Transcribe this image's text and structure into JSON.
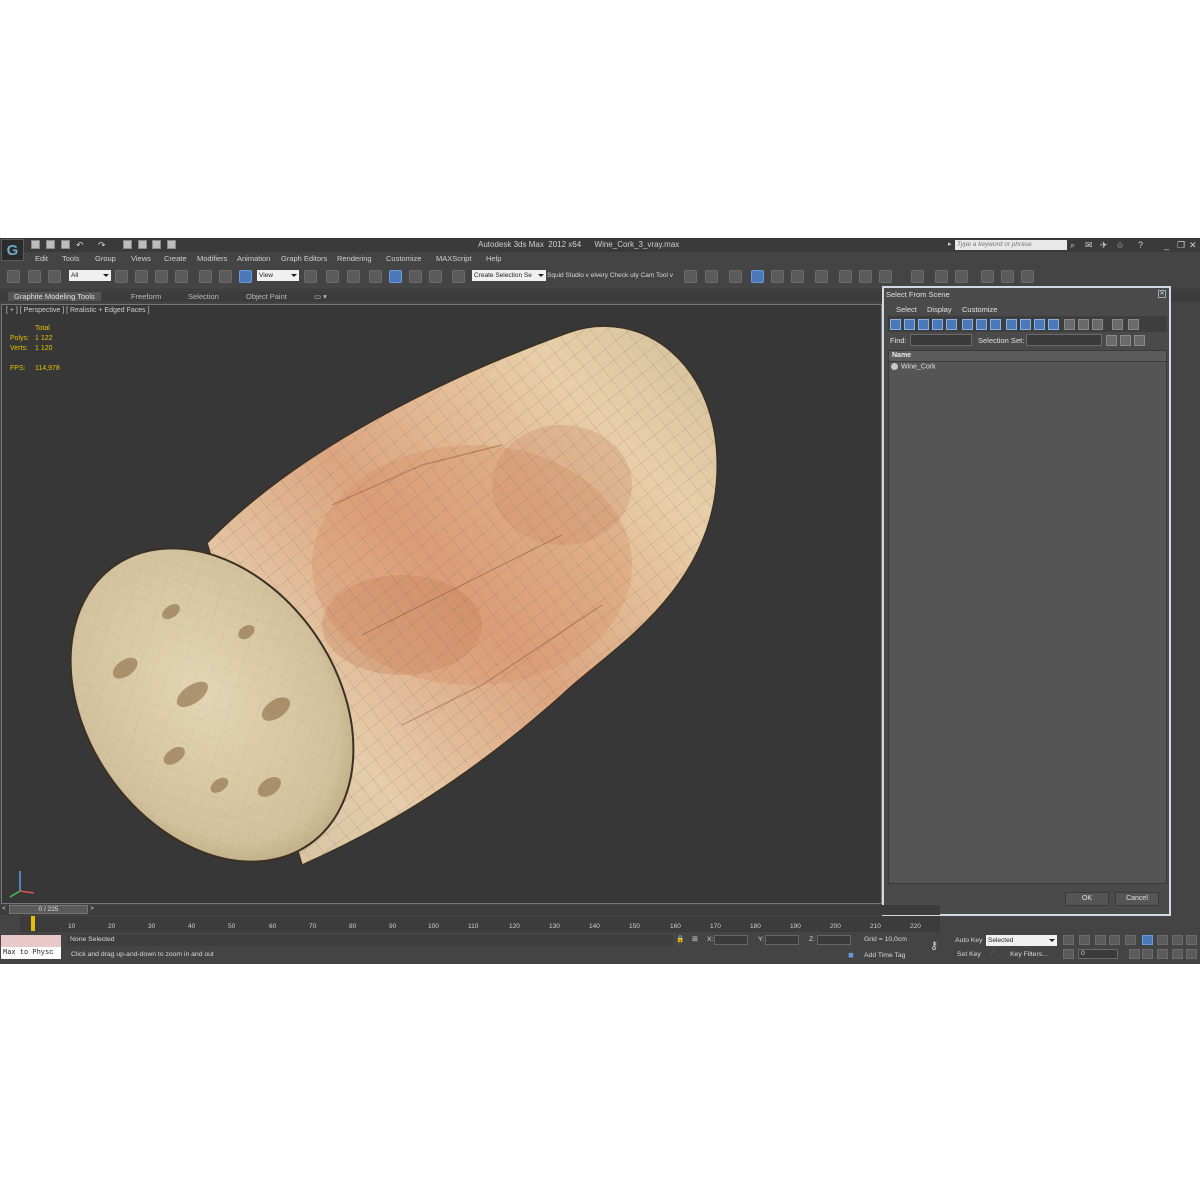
{
  "app": {
    "title": "Autodesk 3ds Max  2012 x64      Wine_Cork_3_vray.max",
    "logo_letter": "G",
    "search_placeholder": "Type a keyword or phrase"
  },
  "menu": [
    "Edit",
    "Tools",
    "Group",
    "Views",
    "Create",
    "Modifiers",
    "Animation",
    "Graph Editors",
    "Rendering",
    "Customize",
    "MAXScript",
    "Help"
  ],
  "toolbar": {
    "filter_value": "All",
    "reference_value": "View",
    "selection_set_value": "Create Selection Se",
    "plugin_text": "Squid Studio v elvery Check  uty Cam Tool v"
  },
  "ribbon": {
    "tabs": [
      "Graphite Modeling Tools",
      "Freeform",
      "Selection",
      "Object Paint"
    ]
  },
  "viewport": {
    "label": "[ + ] [ Perspective ] [ Realistic + Edged Faces ]",
    "stats": {
      "total_label": "Total",
      "polys_label": "Polys:",
      "polys_value": "1 122",
      "verts_label": "Verts:",
      "verts_value": "1 120",
      "fps_label": "FPS:",
      "fps_value": "114,978"
    }
  },
  "dialog": {
    "title": "Select From Scene",
    "menus": [
      "Select",
      "Display",
      "Customize"
    ],
    "find_label": "Find:",
    "selection_set_label": "Selection Set:",
    "column_header": "Name",
    "items": [
      "Wine_Cork"
    ],
    "ok_label": "OK",
    "cancel_label": "Cancel"
  },
  "timeline": {
    "frame_label": "0 / 225",
    "ticks": [
      "10",
      "20",
      "30",
      "40",
      "50",
      "60",
      "70",
      "80",
      "90",
      "100",
      "110",
      "120",
      "130",
      "140",
      "150",
      "160",
      "170",
      "180",
      "190",
      "200",
      "210",
      "220"
    ]
  },
  "status": {
    "script_label": "Max to Physc",
    "selection_text": "None Selected",
    "prompt_text": "Click and drag up-and-down to zoom in and out",
    "x_label": "X:",
    "y_label": "Y:",
    "z_label": "Z:",
    "grid_text": "Grid = 10,0cm",
    "add_time_tag": "Add Time Tag",
    "auto_key": "Auto Key",
    "set_key": "Set Key",
    "selected_value": "Selected",
    "key_filters": "Key Filters...",
    "frame_value": "0"
  },
  "colors": {
    "accent": "#4a78b8",
    "stats_yellow": "#e6c000",
    "cork_light": "#e8d6b0",
    "cork_dark": "#b8865a"
  }
}
